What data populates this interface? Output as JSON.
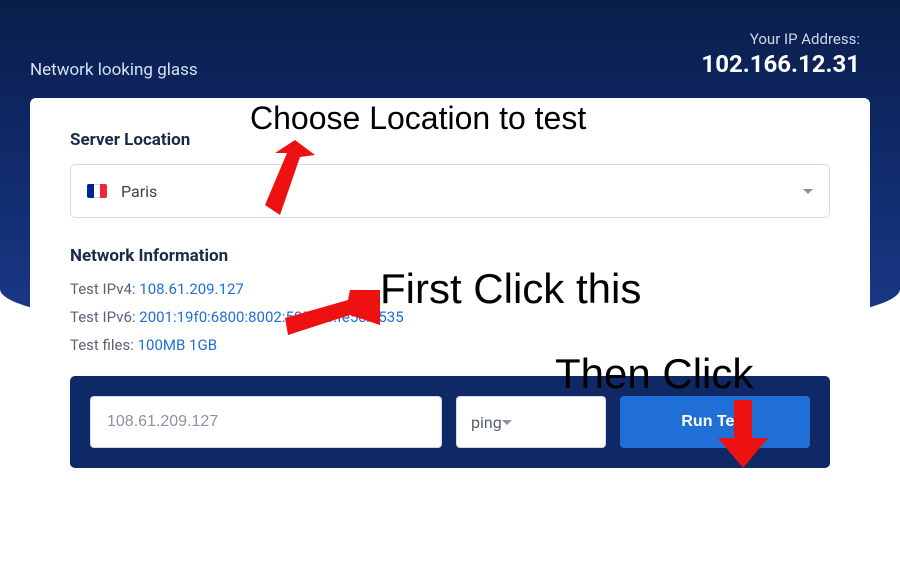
{
  "header": {
    "app_title": "Network looking glass",
    "ip_label": "Your IP Address:",
    "ip_value": "102.166.12.31"
  },
  "location": {
    "section_title": "Server Location",
    "selected": "Paris",
    "flag": "france"
  },
  "network_info": {
    "section_title": "Network Information",
    "ipv4_label": "Test IPv4:",
    "ipv4_value": "108.61.209.127",
    "ipv6_label": "Test IPv6:",
    "ipv6_value": "2001:19f0:6800:8002:5054:ff:fe5e:d535",
    "files_label": "Test files:",
    "file_100mb": "100MB",
    "file_1gb": "1GB"
  },
  "test_form": {
    "host_value": "108.61.209.127",
    "type_value": "ping",
    "run_label": "Run Test"
  },
  "annotations": {
    "choose_location": "Choose Location to test",
    "first_click": "First Click this",
    "then_click": "Then Click"
  }
}
